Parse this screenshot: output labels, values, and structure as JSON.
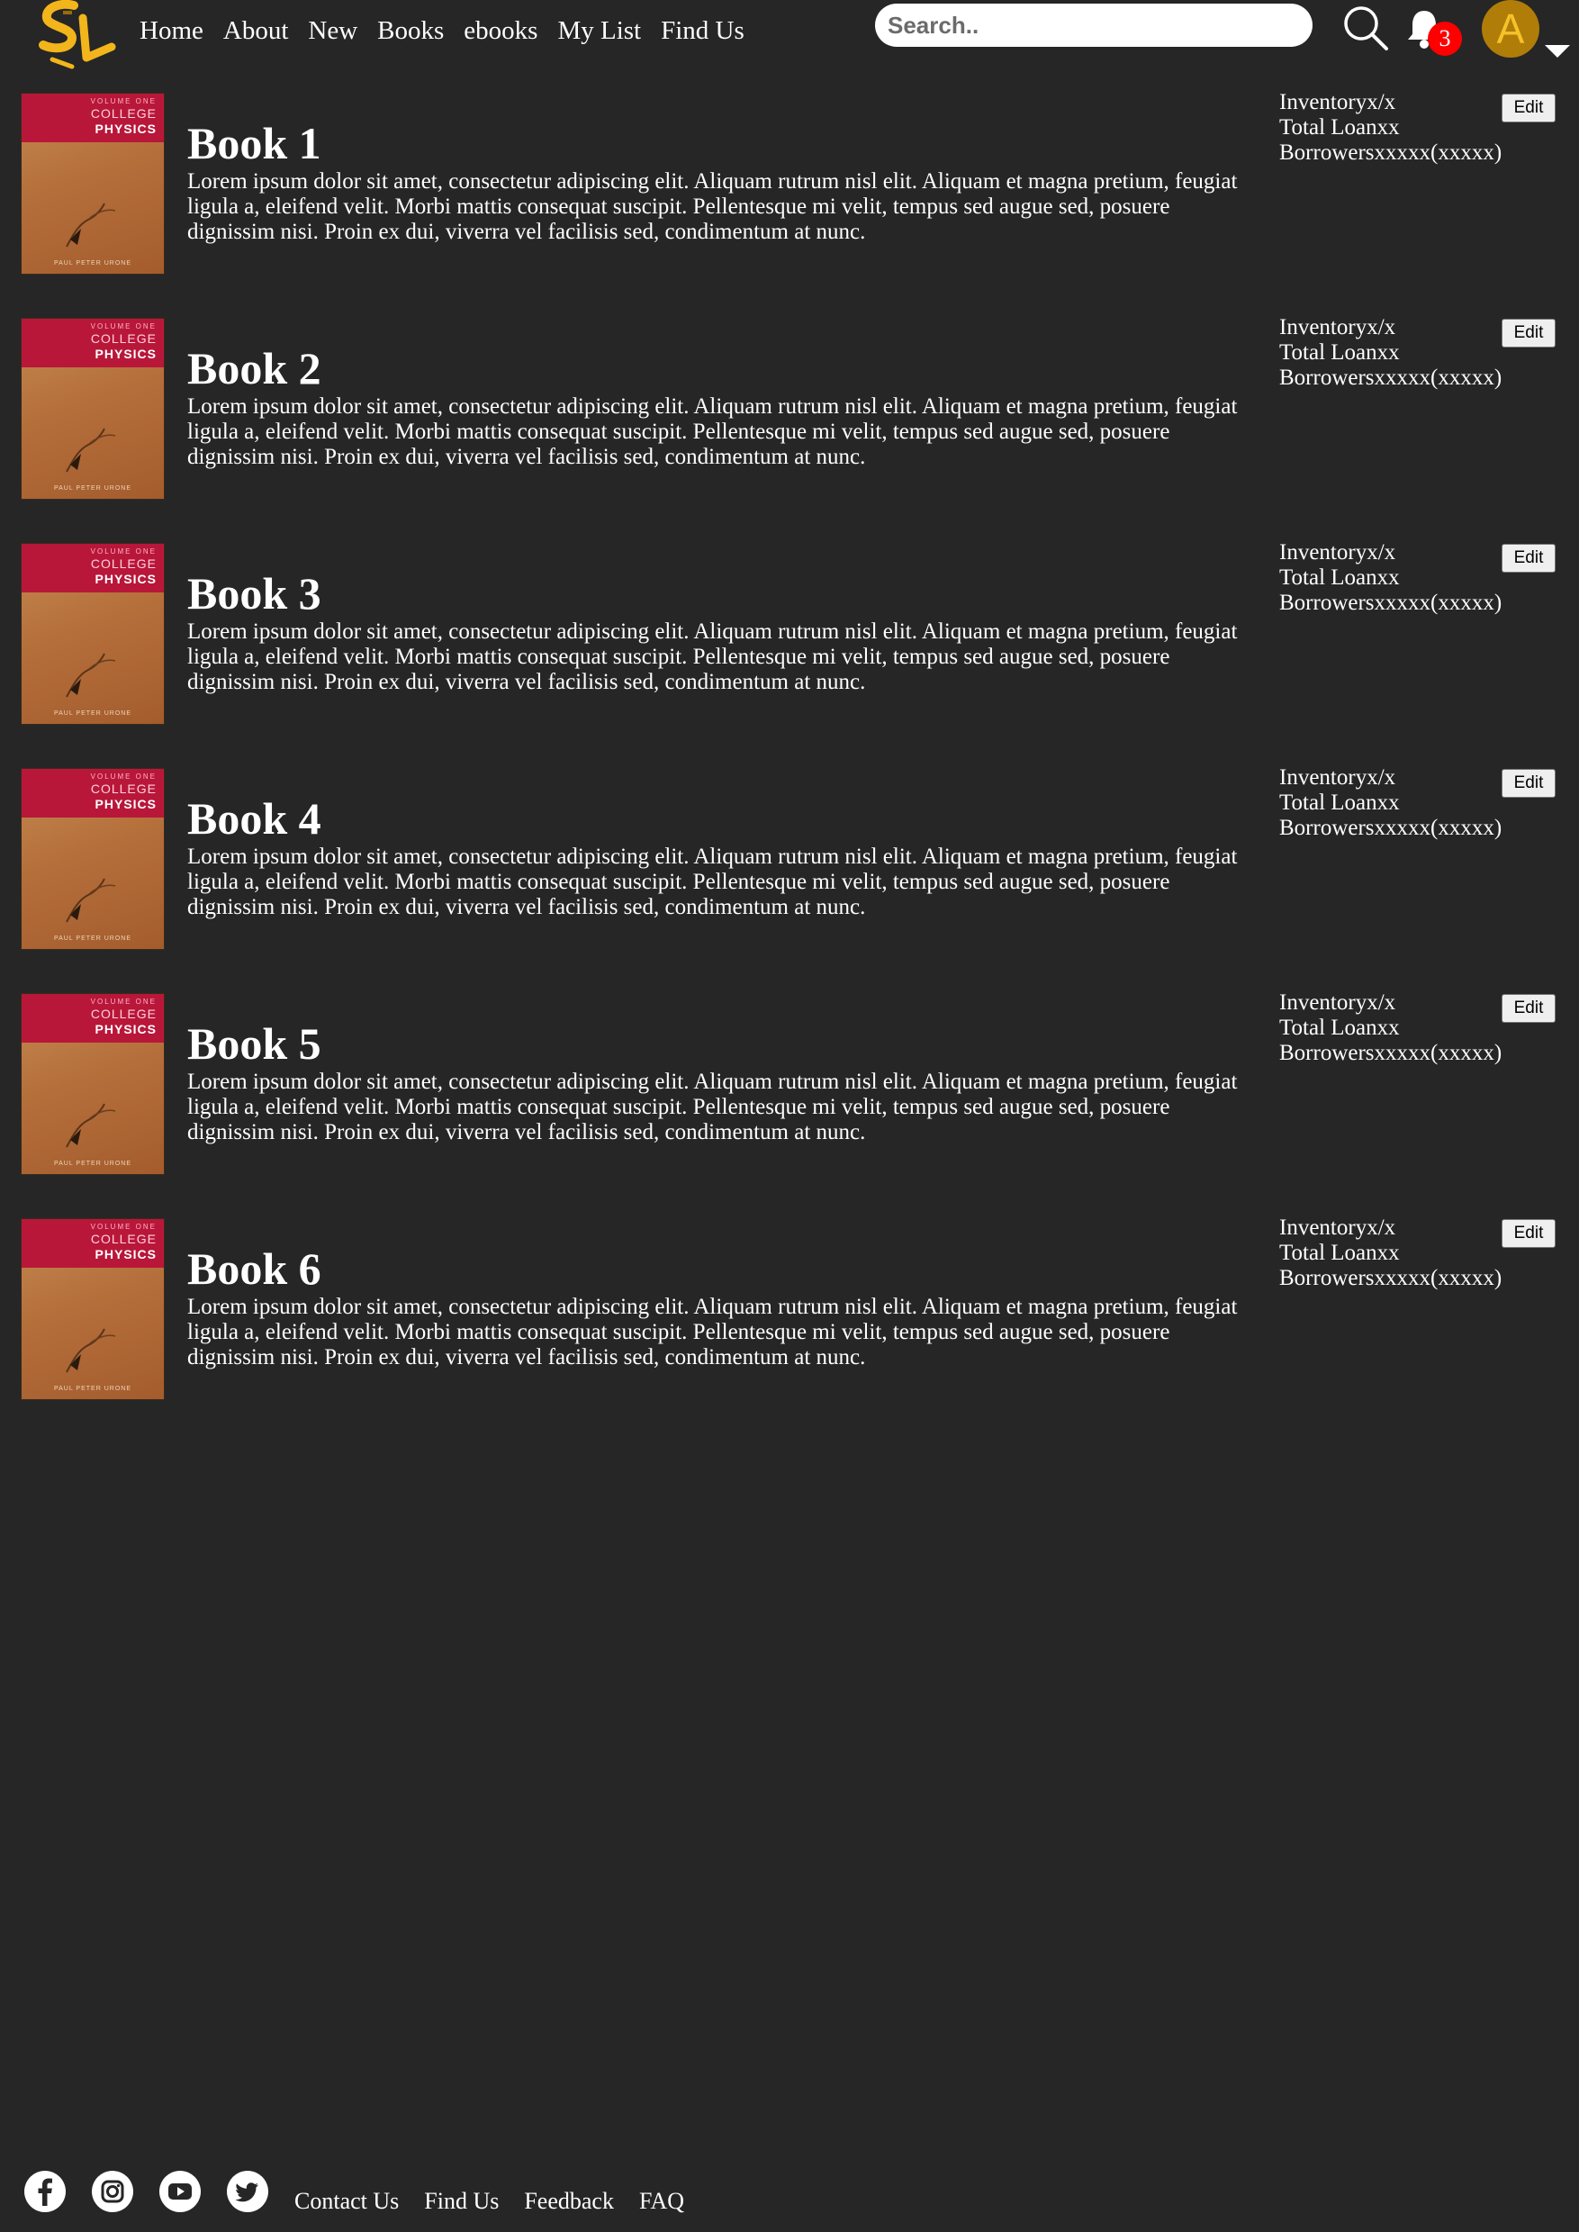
{
  "header": {
    "logo_text": "SL",
    "nav": [
      "Home",
      "About",
      "New",
      "Books",
      "ebooks",
      "My List",
      "Find Us"
    ],
    "search": {
      "placeholder": "Search.."
    },
    "notification_count": "3",
    "avatar_letter": "A",
    "icons": [
      "search-icon",
      "bell-icon",
      "avatar",
      "caret-down-icon"
    ]
  },
  "cover": {
    "volume": "VOLUME ONE",
    "college": "COLLEGE",
    "physics": "PHYSICS",
    "author": "PAUL PETER URONE"
  },
  "books": [
    {
      "title": "Book 1",
      "description": "Lorem ipsum dolor sit amet, consectetur adipiscing elit. Aliquam rutrum nisl elit. Aliquam et magna pretium, feugiat ligula a, eleifend velit. Morbi mattis consequat suscipit. Pellentesque mi velit, tempus sed augue sed, posuere dignissim nisi. Proin ex dui, viverra vel facilisis sed, condimentum at nunc.",
      "inventory": "Inventoryx/x",
      "total_loan": "Total Loanxx",
      "borrowers": "Borrowersxxxxx(xxxxx)",
      "edit": "Edit"
    },
    {
      "title": "Book 2",
      "description": "Lorem ipsum dolor sit amet, consectetur adipiscing elit. Aliquam rutrum nisl elit. Aliquam et magna pretium, feugiat ligula a, eleifend velit. Morbi mattis consequat suscipit. Pellentesque mi velit, tempus sed augue sed, posuere dignissim nisi. Proin ex dui, viverra vel facilisis sed, condimentum at nunc.",
      "inventory": "Inventoryx/x",
      "total_loan": "Total Loanxx",
      "borrowers": "Borrowersxxxxx(xxxxx)",
      "edit": "Edit"
    },
    {
      "title": "Book 3",
      "description": "Lorem ipsum dolor sit amet, consectetur adipiscing elit. Aliquam rutrum nisl elit. Aliquam et magna pretium, feugiat ligula a, eleifend velit. Morbi mattis consequat suscipit. Pellentesque mi velit, tempus sed augue sed, posuere dignissim nisi. Proin ex dui, viverra vel facilisis sed, condimentum at nunc.",
      "inventory": "Inventoryx/x",
      "total_loan": "Total Loanxx",
      "borrowers": "Borrowersxxxxx(xxxxx)",
      "edit": "Edit"
    },
    {
      "title": "Book 4",
      "description": "Lorem ipsum dolor sit amet, consectetur adipiscing elit. Aliquam rutrum nisl elit. Aliquam et magna pretium, feugiat ligula a, eleifend velit. Morbi mattis consequat suscipit. Pellentesque mi velit, tempus sed augue sed, posuere dignissim nisi. Proin ex dui, viverra vel facilisis sed, condimentum at nunc.",
      "inventory": "Inventoryx/x",
      "total_loan": "Total Loanxx",
      "borrowers": "Borrowersxxxxx(xxxxx)",
      "edit": "Edit"
    },
    {
      "title": "Book 5",
      "description": "Lorem ipsum dolor sit amet, consectetur adipiscing elit. Aliquam rutrum nisl elit. Aliquam et magna pretium, feugiat ligula a, eleifend velit. Morbi mattis consequat suscipit. Pellentesque mi velit, tempus sed augue sed, posuere dignissim nisi. Proin ex dui, viverra vel facilisis sed, condimentum at nunc.",
      "inventory": "Inventoryx/x",
      "total_loan": "Total Loanxx",
      "borrowers": "Borrowersxxxxx(xxxxx)",
      "edit": "Edit"
    },
    {
      "title": "Book 6",
      "description": "Lorem ipsum dolor sit amet, consectetur adipiscing elit. Aliquam rutrum nisl elit. Aliquam et magna pretium, feugiat ligula a, eleifend velit. Morbi mattis consequat suscipit. Pellentesque mi velit, tempus sed augue sed, posuere dignissim nisi. Proin ex dui, viverra vel facilisis sed, condimentum at nunc.",
      "inventory": "Inventoryx/x",
      "total_loan": "Total Loanxx",
      "borrowers": "Borrowersxxxxx(xxxxx)",
      "edit": "Edit"
    }
  ],
  "footer": {
    "social": [
      "facebook-icon",
      "instagram-icon",
      "youtube-icon",
      "twitter-icon"
    ],
    "links": [
      "Contact Us",
      "Find Us",
      "Feedback",
      "FAQ"
    ]
  },
  "colors": {
    "background": "#262626",
    "text": "#ffffff",
    "logo": "#f2b51b",
    "cover_band": "#b8173a",
    "badge": "#ff0000",
    "avatar": "#b07d08"
  }
}
